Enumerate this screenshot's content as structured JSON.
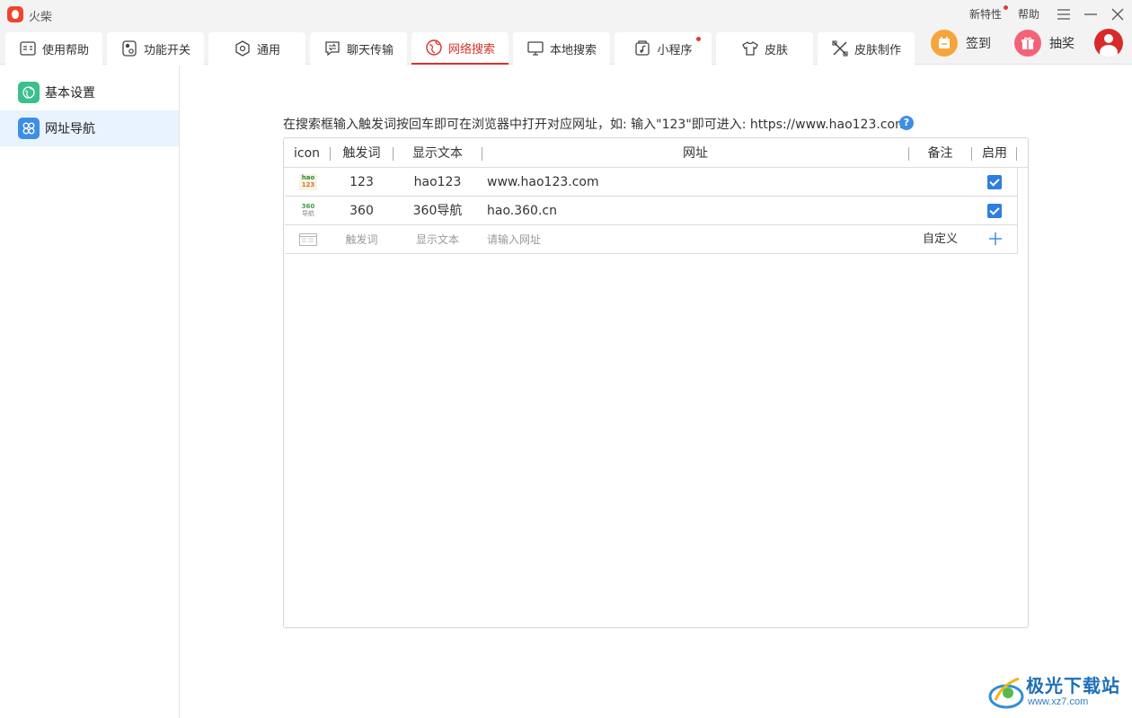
{
  "window": {
    "title": "火柴",
    "links": {
      "new_features": "新特性",
      "help": "帮助"
    }
  },
  "tabs": [
    {
      "label": "使用帮助",
      "icon": "help-card-icon"
    },
    {
      "label": "功能开关",
      "icon": "toggle-icon"
    },
    {
      "label": "通用",
      "icon": "hexagon-icon"
    },
    {
      "label": "聊天传输",
      "icon": "chat-transfer-icon"
    },
    {
      "label": "网络搜索",
      "icon": "web-search-icon",
      "active": true
    },
    {
      "label": "本地搜索",
      "icon": "monitor-icon"
    },
    {
      "label": "小程序",
      "icon": "music-box-icon",
      "dot": true
    },
    {
      "label": "皮肤",
      "icon": "tshirt-icon"
    },
    {
      "label": "皮肤制作",
      "icon": "tools-icon"
    }
  ],
  "actions": {
    "checkin": "签到",
    "lottery": "抽奖"
  },
  "sidebar": {
    "items": [
      {
        "label": "基本设置",
        "icon": "basic-settings-icon"
      },
      {
        "label": "网址导航",
        "icon": "url-nav-icon",
        "active": true
      }
    ]
  },
  "main": {
    "hint": "在搜索框输入触发词按回车即可在浏览器中打开对应网址，如: 输入\"123\"即可进入: https://www.hao123.com",
    "columns": {
      "icon": "icon",
      "trigger": "触发词",
      "display": "显示文本",
      "url": "网址",
      "note": "备注",
      "enabled": "启用"
    },
    "rows": [
      {
        "icon_text_top": "hao",
        "icon_text_bottom": "123",
        "trigger": "123",
        "display": "hao123",
        "url": "www.hao123.com",
        "note": "",
        "enabled": true
      },
      {
        "icon_text_top": "360",
        "icon_text_bottom": "导航",
        "trigger": "360",
        "display": "360导航",
        "url": "hao.360.cn",
        "note": "",
        "enabled": true
      }
    ],
    "new_row": {
      "trigger_placeholder": "触发词",
      "display_placeholder": "显示文本",
      "url_placeholder": "请输入网址",
      "custom_label": "自定义"
    }
  },
  "watermark": {
    "title": "极光下载站",
    "url": "www.xz7.com"
  },
  "colors": {
    "accent_red": "#d9312b",
    "checkbox_blue": "#2d7fe0",
    "sidebar_active": "#e9f3fd"
  }
}
